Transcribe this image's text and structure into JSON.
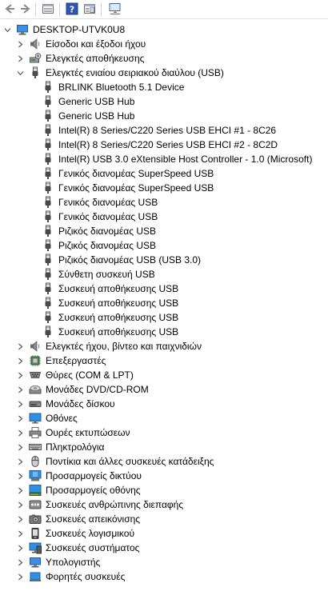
{
  "toolbar": {
    "buttons": [
      {
        "name": "back-button",
        "icon": "arrow-left-icon"
      },
      {
        "name": "forward-button",
        "icon": "arrow-right-icon"
      },
      {
        "name": "properties-view-button",
        "icon": "properties-grid-icon"
      },
      {
        "name": "help-button",
        "icon": "help-icon"
      },
      {
        "name": "action-pane-button",
        "icon": "pane-icon"
      },
      {
        "name": "scan-hardware-button",
        "icon": "monitor-scan-icon"
      }
    ]
  },
  "tree": {
    "root": {
      "label": "DESKTOP-UTVK0U8",
      "icon": "computer-icon",
      "expanded": true
    },
    "categories_before": [
      {
        "label": "Είσοδοι και έξοδοι ήχου",
        "icon": "speaker-icon"
      },
      {
        "label": "Ελεγκτές αποθήκευσης",
        "icon": "storage-controller-icon"
      }
    ],
    "usb": {
      "label": "Ελεγκτές ενιαίου σειριακού διαύλου (USB)",
      "icon": "usb-icon",
      "expanded": true,
      "children": [
        "BRLINK Bluetooth 5.1 Device",
        "Generic USB Hub",
        "Generic USB Hub",
        "Intel(R) 8 Series/C220 Series USB EHCI #1 - 8C26",
        "Intel(R) 8 Series/C220 Series USB EHCI #2 - 8C2D",
        "Intel(R) USB 3.0 eXtensible Host Controller - 1.0 (Microsoft)",
        "Γενικός διανομέας SuperSpeed USB",
        "Γενικός διανομέας SuperSpeed USB",
        "Γενικός διανομέας USB",
        "Γενικός διανομέας USB",
        "Ριζικός διανομέας USB",
        "Ριζικός διανομέας USB",
        "Ριζικός διανομέας USB (USB 3.0)",
        "Σύνθετη συσκευή USB",
        "Συσκευή αποθήκευσης USB",
        "Συσκευή αποθήκευσης USB",
        "Συσκευή αποθήκευσης USB",
        "Συσκευή αποθήκευσης USB"
      ]
    },
    "categories_after": [
      {
        "label": "Ελεγκτές ήχου, βίντεο και παιχνιδιών",
        "icon": "speaker-icon"
      },
      {
        "label": "Επεξεργαστές",
        "icon": "processor-icon"
      },
      {
        "label": "Θύρες (COM & LPT)",
        "icon": "port-icon"
      },
      {
        "label": "Μονάδες DVD/CD-ROM",
        "icon": "dvd-drive-icon"
      },
      {
        "label": "Μονάδες δίσκου",
        "icon": "disk-drive-icon"
      },
      {
        "label": "Οθόνες",
        "icon": "monitor-icon"
      },
      {
        "label": "Ουρές εκτυπώσεων",
        "icon": "printer-icon"
      },
      {
        "label": "Πληκτρολόγια",
        "icon": "keyboard-icon"
      },
      {
        "label": "Ποντίκια και άλλες συσκευές κατάδειξης",
        "icon": "mouse-icon"
      },
      {
        "label": "Προσαρμογείς δικτύου",
        "icon": "network-adapter-icon"
      },
      {
        "label": "Προσαρμογείς οθόνης",
        "icon": "display-adapter-icon"
      },
      {
        "label": "Συσκευές ανθρώπινης διεπαφής",
        "icon": "hid-icon"
      },
      {
        "label": "Συσκευές απεικόνισης",
        "icon": "camera-icon"
      },
      {
        "label": "Συσκευές λογισμικού",
        "icon": "software-device-icon"
      },
      {
        "label": "Συσκευές συστήματος",
        "icon": "system-device-icon"
      },
      {
        "label": "Υπολογιστής",
        "icon": "computer-icon"
      },
      {
        "label": "Φορητές συσκευές",
        "icon": "portable-device-icon"
      }
    ]
  },
  "colors": {
    "accent": "#1a73c8",
    "icon_gray": "#4a4a4a",
    "chevron": "#5a5a5a"
  }
}
